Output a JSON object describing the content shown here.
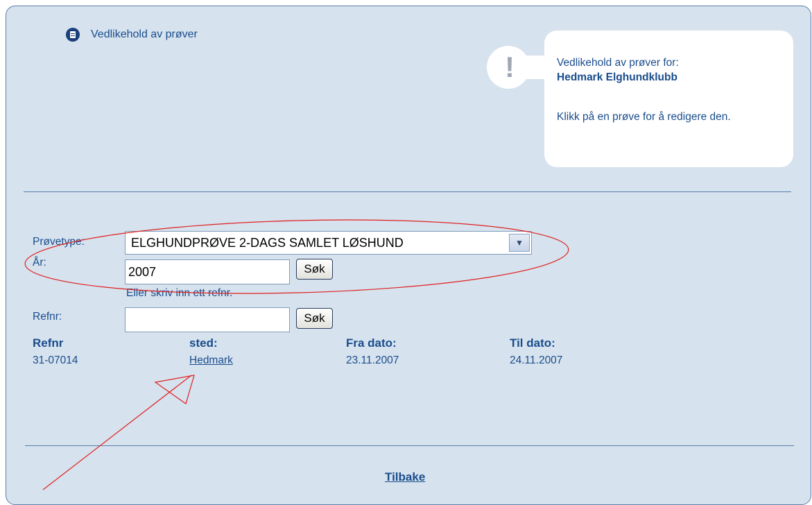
{
  "header": {
    "icon": "document-icon",
    "title": "Vedlikehold av prøver"
  },
  "info_box": {
    "icon": "exclamation-icon",
    "line1": "Vedlikehold av prøver for:",
    "org": "Hedmark Elghundklubb",
    "hint": "Klikk på en prøve for å redigere den."
  },
  "form": {
    "provetype_label": "Prøvetype:",
    "provetype_value": "ELGHUNDPRØVE 2-DAGS SAMLET LØSHUND",
    "ar_label": "År:",
    "ar_value": "2007",
    "search_label": "Søk",
    "or_hint": "Eller skriv inn ett refnr.",
    "refnr_label": "Refnr:",
    "refnr_value": "",
    "search2_label": "Søk"
  },
  "results": {
    "columns": [
      "Refnr",
      "sted:",
      "Fra dato:",
      "Til dato:"
    ],
    "rows": [
      {
        "refnr": "31-07014",
        "sted": "Hedmark",
        "fra": "23.11.2007",
        "til": "24.11.2007"
      }
    ]
  },
  "footer": {
    "back_label": "Tilbake"
  },
  "colors": {
    "panel_bg": "#d6e2ee",
    "text": "#1a4d8c",
    "annotation": "#e02020"
  }
}
